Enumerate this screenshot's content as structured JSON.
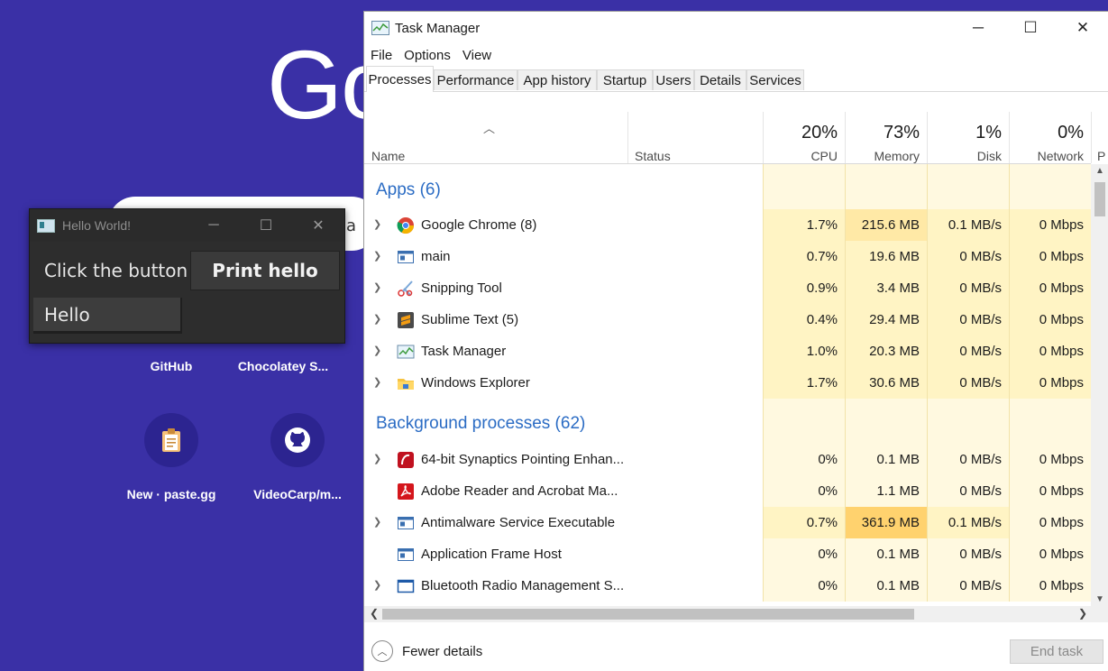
{
  "background": {
    "logo_text": "Go",
    "search_partial": "a",
    "shortcuts": [
      {
        "label": "GitHub",
        "icon": "github-icon"
      },
      {
        "label": "Chocolatey S...",
        "icon": "chocolatey-icon"
      },
      {
        "label": "New · paste.gg",
        "icon": "clipboard-icon"
      },
      {
        "label": "VideoCarp/m...",
        "icon": "github-icon"
      }
    ]
  },
  "hello_window": {
    "title": "Hello World!",
    "label": "Click the button",
    "button": "Print hello",
    "entry_value": "Hello"
  },
  "task_manager": {
    "title": "Task Manager",
    "menu": [
      "File",
      "Options",
      "View"
    ],
    "tabs": [
      "Processes",
      "Performance",
      "App history",
      "Startup",
      "Users",
      "Details",
      "Services"
    ],
    "active_tab": "Processes",
    "columns": {
      "name": "Name",
      "status": "Status",
      "cpu": {
        "pct": "20%",
        "label": "CPU"
      },
      "memory": {
        "pct": "73%",
        "label": "Memory"
      },
      "disk": {
        "pct": "1%",
        "label": "Disk"
      },
      "network": {
        "pct": "0%",
        "label": "Network"
      },
      "extra": "P"
    },
    "groups": [
      {
        "title": "Apps (6)",
        "rows": [
          {
            "name": "Google Chrome (8)",
            "icon": "chrome-icon",
            "expand": true,
            "cpu": "1.7%",
            "memory": "215.6 MB",
            "disk": "0.1 MB/s",
            "network": "0 Mbps",
            "mem_hi": true
          },
          {
            "name": "main",
            "icon": "app-window-icon",
            "expand": true,
            "cpu": "0.7%",
            "memory": "19.6 MB",
            "disk": "0 MB/s",
            "network": "0 Mbps"
          },
          {
            "name": "Snipping Tool",
            "icon": "scissors-icon",
            "expand": true,
            "cpu": "0.9%",
            "memory": "3.4 MB",
            "disk": "0 MB/s",
            "network": "0 Mbps"
          },
          {
            "name": "Sublime Text (5)",
            "icon": "sublime-icon",
            "expand": true,
            "cpu": "0.4%",
            "memory": "29.4 MB",
            "disk": "0 MB/s",
            "network": "0 Mbps"
          },
          {
            "name": "Task Manager",
            "icon": "task-manager-icon",
            "expand": true,
            "cpu": "1.0%",
            "memory": "20.3 MB",
            "disk": "0 MB/s",
            "network": "0 Mbps"
          },
          {
            "name": "Windows Explorer",
            "icon": "folder-icon",
            "expand": true,
            "cpu": "1.7%",
            "memory": "30.6 MB",
            "disk": "0 MB/s",
            "network": "0 Mbps"
          }
        ]
      },
      {
        "title": "Background processes (62)",
        "rows": [
          {
            "name": "64-bit Synaptics Pointing Enhan...",
            "icon": "synaptics-icon",
            "expand": true,
            "cpu": "0%",
            "memory": "0.1 MB",
            "disk": "0 MB/s",
            "network": "0 Mbps"
          },
          {
            "name": "Adobe Reader and Acrobat Ma...",
            "icon": "acrobat-icon",
            "expand": false,
            "cpu": "0%",
            "memory": "1.1 MB",
            "disk": "0 MB/s",
            "network": "0 Mbps"
          },
          {
            "name": "Antimalware Service Executable",
            "icon": "app-window-icon",
            "expand": true,
            "cpu": "0.7%",
            "memory": "361.9 MB",
            "disk": "0.1 MB/s",
            "network": "0 Mbps",
            "mem_hi2": true
          },
          {
            "name": "Application Frame Host",
            "icon": "app-window-icon",
            "expand": false,
            "cpu": "0%",
            "memory": "0.1 MB",
            "disk": "0 MB/s",
            "network": "0 Mbps"
          },
          {
            "name": "Bluetooth Radio Management S...",
            "icon": "window-icon",
            "expand": true,
            "cpu": "0%",
            "memory": "0.1 MB",
            "disk": "0 MB/s",
            "network": "0 Mbps"
          }
        ]
      }
    ],
    "fewer_details": "Fewer details",
    "end_task": "End task",
    "colors": {
      "group_title": "#2b6cc4",
      "cell_light": "#fff4c4",
      "cell_lighter": "#fff9e0",
      "cell_medium": "#ffe9a6",
      "cell_hot": "#ffd26e"
    }
  }
}
